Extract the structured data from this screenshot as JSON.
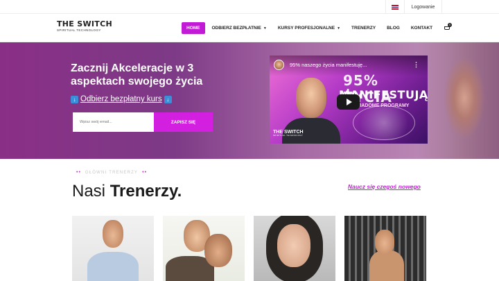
{
  "topbar": {
    "language_icon": "uk-flag-icon",
    "login_label": "Logowanie"
  },
  "header": {
    "logo_line1": "THE SWITCH",
    "logo_line2": "SPIRITUAL TECHNOLOGY",
    "nav": [
      {
        "label": "HOME",
        "active": true
      },
      {
        "label": "ODBIERZ BEZPŁATNIE",
        "dropdown": true
      },
      {
        "label": "KURSY PROFESJONALNE",
        "dropdown": true
      },
      {
        "label": "TRENERZY"
      },
      {
        "label": "BLOG"
      },
      {
        "label": "KONTAKT"
      }
    ],
    "cart_icon": "cart-icon",
    "cart_count": "0"
  },
  "hero": {
    "title": "Zacznij Akceleracje w 3 aspektach swojego życia",
    "link_text": "Odbierz bezpłatny kurs",
    "email_placeholder": "Wpisz swój email...",
    "submit_label": "ZAPISZ SIĘ",
    "accent_color": "#d21fe0"
  },
  "video": {
    "title": "95% naszego życia manifestuję...",
    "overlay_line1": "95% ŻYCIA",
    "overlay_line2": "MANIFESTUJĄ",
    "overlay_line3": "ŚWIADOME PROGRAMY",
    "logo_line1": "THE SWITCH",
    "logo_line2": "SPIRITUAL TECHNOLOGY"
  },
  "trainers": {
    "kicker": "GŁÓWNI TRENERZY",
    "title_light": "Nasi",
    "title_bold": "Trenerzy.",
    "learn_link": "Naucz się czegoś nowego"
  }
}
